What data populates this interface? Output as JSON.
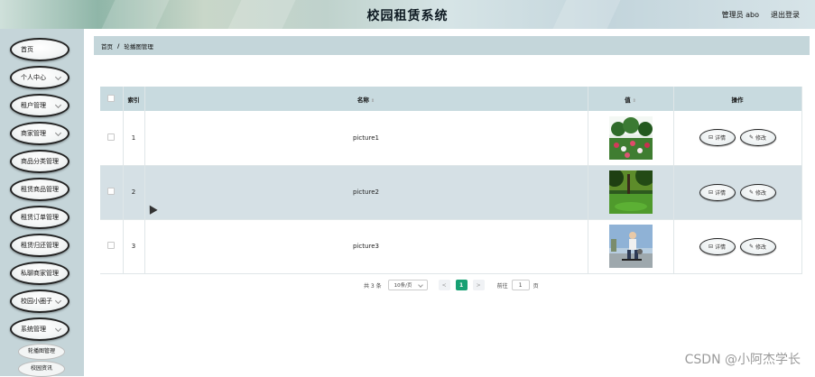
{
  "header": {
    "title": "校园租赁系统",
    "admin_label": "管理员 abo",
    "logout_label": "退出登录"
  },
  "sidebar": {
    "items": [
      {
        "label": "首页",
        "has_chevron": false
      },
      {
        "label": "个人中心",
        "has_chevron": true
      },
      {
        "label": "租户管理",
        "has_chevron": true
      },
      {
        "label": "商家管理",
        "has_chevron": true
      },
      {
        "label": "商品分类管理",
        "has_chevron": false
      },
      {
        "label": "租赁商品管理",
        "has_chevron": false
      },
      {
        "label": "租赁订单管理",
        "has_chevron": false
      },
      {
        "label": "租赁归还管理",
        "has_chevron": false
      },
      {
        "label": "私聊商家管理",
        "has_chevron": false
      },
      {
        "label": "校园小圈子",
        "has_chevron": true
      },
      {
        "label": "系统管理",
        "has_chevron": true
      }
    ],
    "sub_items": [
      {
        "label": "轮播图管理"
      },
      {
        "label": "校园资讯"
      }
    ]
  },
  "breadcrumb": {
    "home": "首页",
    "separator": "/",
    "current": "轮播图管理"
  },
  "table": {
    "columns": {
      "index": "索引",
      "name": "名称",
      "value": "值",
      "actions": "操作"
    },
    "rows": [
      {
        "index": "1",
        "name": "picture1",
        "image": "flowers-park"
      },
      {
        "index": "2",
        "name": "picture2",
        "image": "green-lawn"
      },
      {
        "index": "3",
        "name": "picture3",
        "image": "skateboard-kid"
      }
    ],
    "detail_label": "详情",
    "edit_label": "修改"
  },
  "pagination": {
    "total_text": "共 3 条",
    "page_size": "10条/页",
    "prev": "<",
    "current_page": "1",
    "next": ">",
    "goto_label": "前往",
    "goto_value": "1",
    "goto_suffix": "页"
  },
  "watermark": "CSDN @小阿杰学长",
  "colors": {
    "sidebar_bg": "#c5d5d9",
    "breadcrumb_bg": "#c4d6da",
    "table_header_bg": "#c8dadf",
    "accent": "#17a073"
  }
}
